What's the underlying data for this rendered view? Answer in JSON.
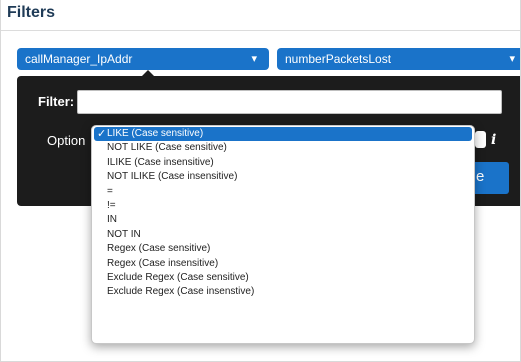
{
  "section": {
    "title": "Filters"
  },
  "fields": {
    "first": "callManager_IpAddr",
    "second": "numberPacketsLost"
  },
  "filter_popup": {
    "filter_label": "Filter:",
    "filter_value": "",
    "options_label": "Option",
    "info_icon": "i",
    "apply_button_label": "e"
  },
  "operator_dropdown": {
    "selected_index": 0,
    "options": [
      "LIKE (Case sensitive)",
      "NOT LIKE (Case sensitive)",
      "ILIKE (Case insensitive)",
      "NOT ILIKE (Case insensitive)",
      "=",
      "!=",
      "IN",
      "NOT IN",
      "Regex (Case sensitive)",
      "Regex (Case insensitive)",
      "Exclude Regex (Case sensitive)",
      "Exclude Regex (Case insenstive)"
    ]
  },
  "colors": {
    "accent": "#1a73c9",
    "popup_background": "#1c1c1c",
    "title_text": "#1f3b57"
  },
  "icons": {
    "caret": "chevron-down-icon",
    "check": "check-icon",
    "info": "info-icon"
  }
}
